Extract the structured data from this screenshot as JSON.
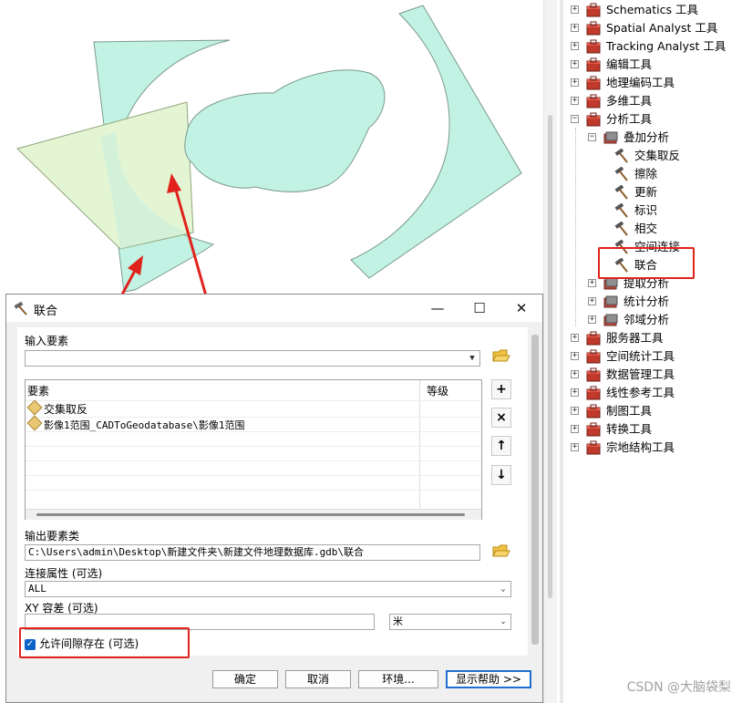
{
  "toolbox": {
    "items": [
      {
        "label": "Schematics 工具",
        "expander": "+"
      },
      {
        "label": "Spatial Analyst 工具",
        "expander": "+"
      },
      {
        "label": "Tracking Analyst 工具",
        "expander": "+"
      },
      {
        "label": "编辑工具",
        "expander": "+"
      },
      {
        "label": "地理编码工具",
        "expander": "+"
      },
      {
        "label": "多维工具",
        "expander": "+"
      },
      {
        "label": "分析工具",
        "expander": "−"
      },
      {
        "label": "叠加分析",
        "expander": "−"
      },
      {
        "label": "交集取反"
      },
      {
        "label": "擦除"
      },
      {
        "label": "更新"
      },
      {
        "label": "标识"
      },
      {
        "label": "相交"
      },
      {
        "label": "空间连接"
      },
      {
        "label": "联合"
      },
      {
        "label": "提取分析",
        "expander": "+"
      },
      {
        "label": "统计分析",
        "expander": "+"
      },
      {
        "label": "邻域分析",
        "expander": "+"
      },
      {
        "label": "服务器工具",
        "expander": "+"
      },
      {
        "label": "空间统计工具",
        "expander": "+"
      },
      {
        "label": "数据管理工具",
        "expander": "+"
      },
      {
        "label": "线性参考工具",
        "expander": "+"
      },
      {
        "label": "制图工具",
        "expander": "+"
      },
      {
        "label": "转换工具",
        "expander": "+"
      },
      {
        "label": "宗地结构工具",
        "expander": "+"
      }
    ]
  },
  "dialog": {
    "title": "联合",
    "window_controls": {
      "minimize": "—",
      "maximize": "☐",
      "close": "✕"
    },
    "input_features_label": "输入要素",
    "input_features_value": "",
    "table": {
      "headers": [
        "要素",
        "等级"
      ],
      "rows": [
        {
          "feature": "交集取反",
          "rank": ""
        },
        {
          "feature": "影像1范围_CADToGeodatabase\\影像1范围",
          "rank": ""
        }
      ]
    },
    "side_buttons": {
      "add": "+",
      "remove": "×",
      "up": "↑",
      "down": "↓"
    },
    "output_label": "输出要素类",
    "output_value": "C:\\Users\\admin\\Desktop\\新建文件夹\\新建文件地理数据库.gdb\\联合",
    "join_attr_label": "连接属性 (可选)",
    "join_attr_value": "ALL",
    "xy_tol_label": "XY 容差 (可选)",
    "xy_tol_value": "",
    "xy_tol_unit": "米",
    "gaps_label": "允许间隙存在 (可选)",
    "gaps_checked": true,
    "buttons": {
      "ok": "确定",
      "cancel": "取消",
      "env": "环境...",
      "help": "显示帮助 >>"
    }
  },
  "watermark": "CSDN @大脑袋梨",
  "colors": {
    "polygon_cyan": "#c2f2e4",
    "polygon_green": "#e4f5d4",
    "arrow_red": "#e0231c",
    "highlight_red": "#e0231c"
  }
}
